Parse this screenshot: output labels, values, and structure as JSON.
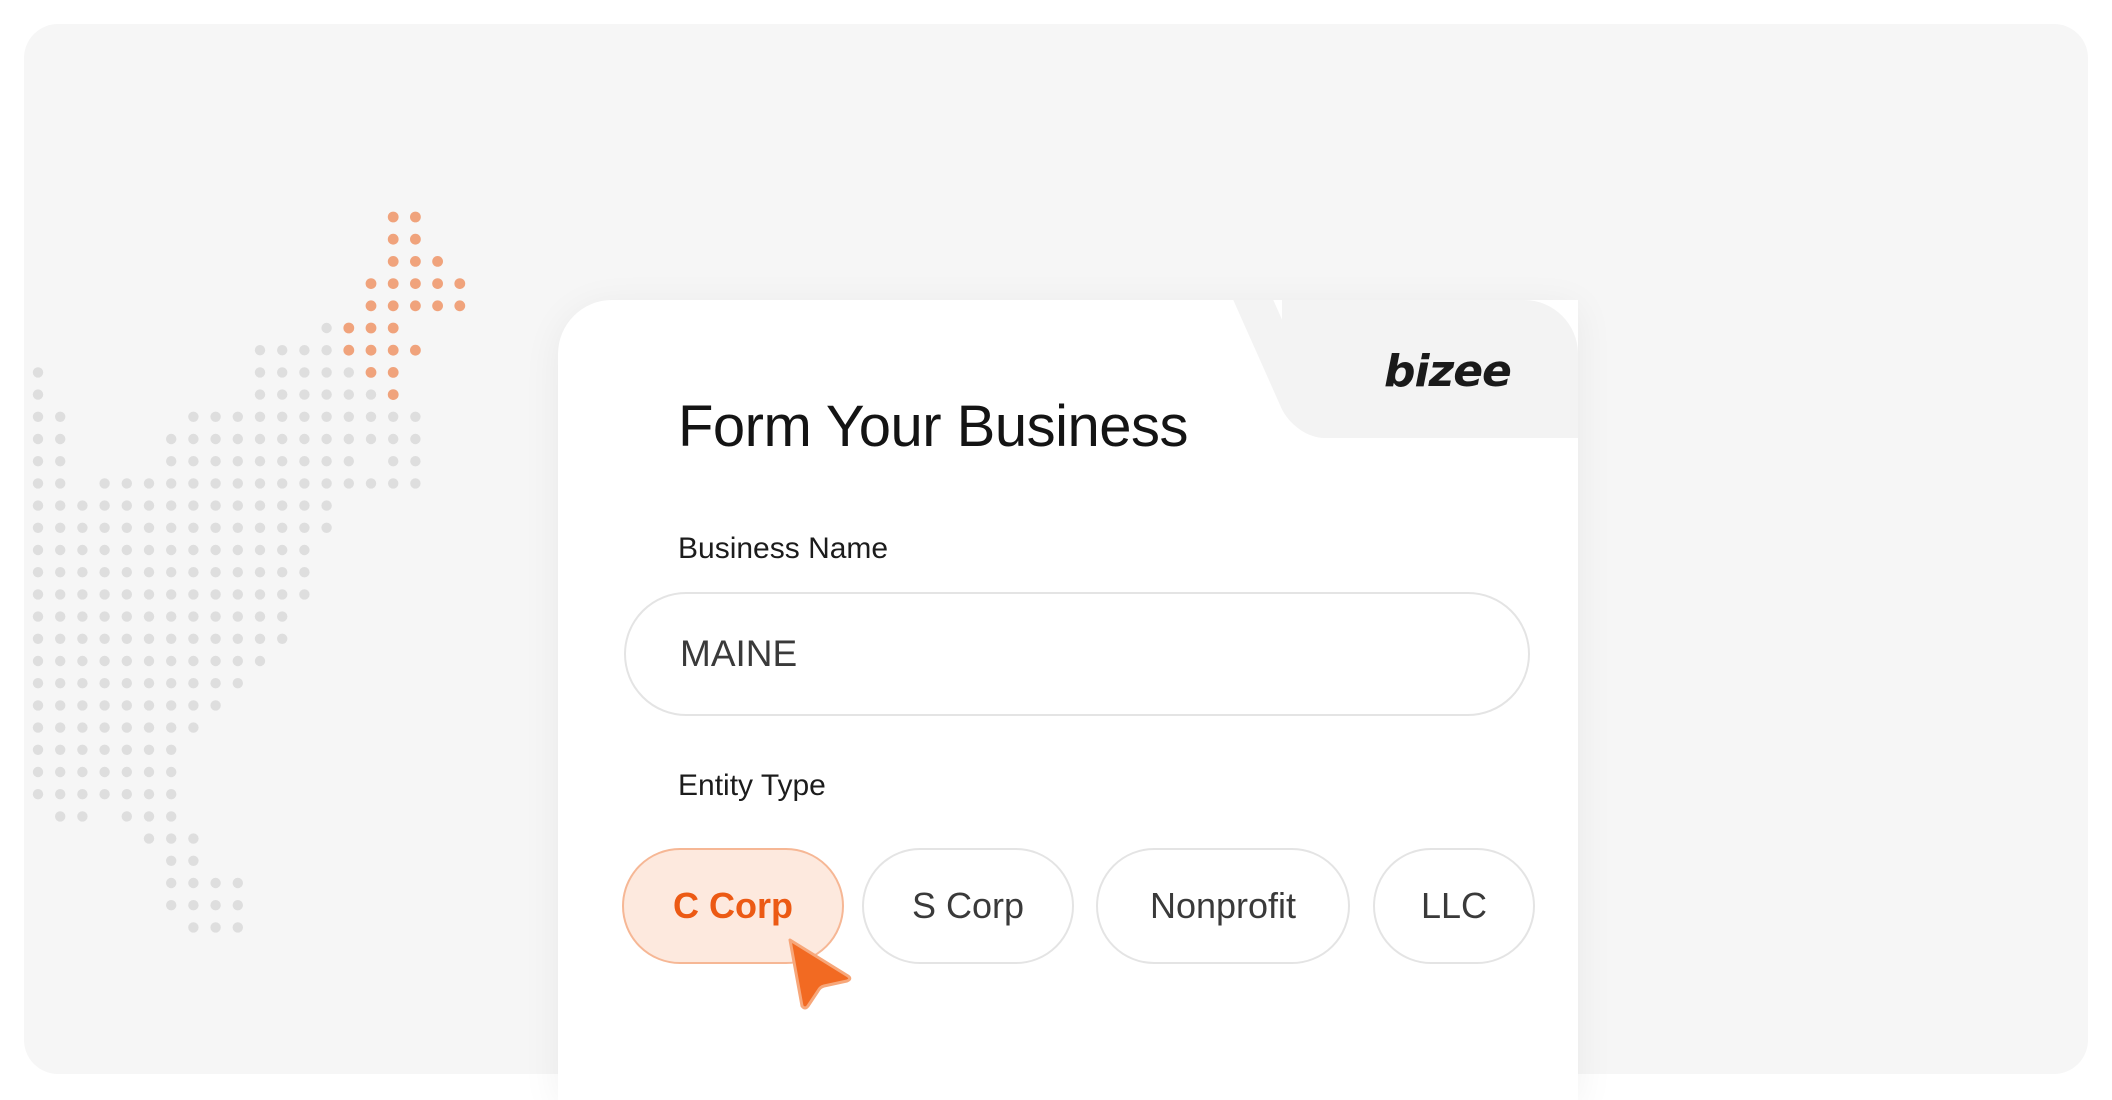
{
  "brand": {
    "logo_text": "bizee"
  },
  "form": {
    "title": "Form Your Business",
    "business_name_label": "Business Name",
    "business_name_value": "MAINE",
    "entity_type_label": "Entity Type",
    "entity_types": [
      "C Corp",
      "S Corp",
      "Nonprofit",
      "LLC"
    ],
    "selected_entity_type": "C Corp"
  },
  "colors": {
    "accent": "#ec5a14",
    "accent_light": "#fde9de",
    "dot_gray": "#dedede",
    "dot_orange": "#f0a37c"
  }
}
